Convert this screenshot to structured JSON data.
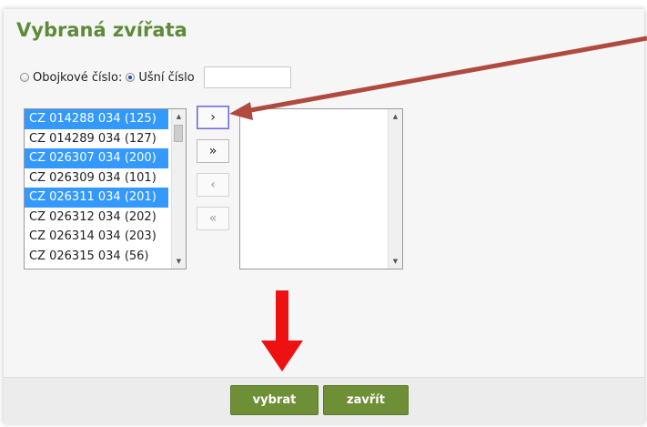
{
  "dialog": {
    "title": "Vybraná zvířata"
  },
  "filter": {
    "options": [
      {
        "label": "Obojkové číslo:",
        "checked": false
      },
      {
        "label": "Ušní číslo",
        "checked": true
      }
    ],
    "ear_number_value": ""
  },
  "available_list": {
    "items": [
      {
        "label": "CZ 014288 034 (125)",
        "selected": true
      },
      {
        "label": "CZ 014289 034 (127)",
        "selected": false
      },
      {
        "label": "CZ 026307 034 (200)",
        "selected": true
      },
      {
        "label": "CZ 026309 034 (101)",
        "selected": false
      },
      {
        "label": "CZ 026311 034 (201)",
        "selected": true
      },
      {
        "label": "CZ 026312 034 (202)",
        "selected": false
      },
      {
        "label": "CZ 026314 034 (203)",
        "selected": false
      },
      {
        "label": "CZ 026315 034 (56)",
        "selected": false
      }
    ]
  },
  "selected_list": {
    "items": []
  },
  "move_buttons": {
    "move_selected": "›",
    "move_all": "»",
    "remove_selected": "‹",
    "remove_all": "«"
  },
  "footer": {
    "select_label": "vybrat",
    "close_label": "zavřít"
  },
  "colors": {
    "title": "#5d8b39",
    "selection": "#3399ff",
    "primary_button": "#6f8f37",
    "annotation_arrow": "#b04a3e",
    "annotation_down_arrow": "#ee1111"
  }
}
